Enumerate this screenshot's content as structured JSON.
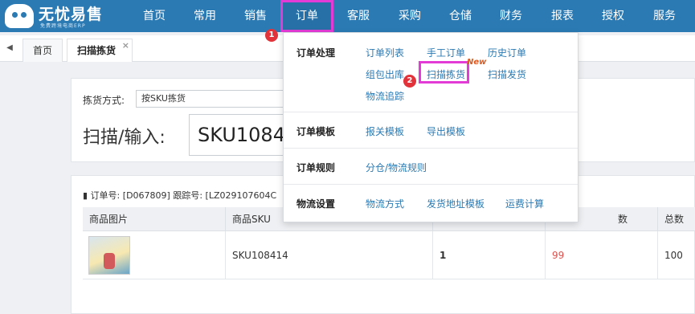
{
  "brand": {
    "title": "无忧易售",
    "subtitle": "免费跨境电商ERP"
  },
  "nav": [
    "首页",
    "常用",
    "销售",
    "订单",
    "客服",
    "采购",
    "仓储",
    "财务",
    "报表",
    "授权",
    "服务"
  ],
  "active_nav": "订单",
  "tabs": [
    "首页",
    "扫描拣货"
  ],
  "picking": {
    "method_label": "拣货方式:",
    "method_value": "按SKU拣货",
    "scan_label": "扫描/输入:",
    "scan_value": "SKU1084"
  },
  "order": {
    "order_no_label": "订单号:",
    "order_no": "[D067809]",
    "tracking_label": "跟踪号:",
    "tracking_no": "[LZ029107604C"
  },
  "table": {
    "headers": [
      "商品图片",
      "商品SKU",
      "",
      "数",
      "总数"
    ],
    "rows": [
      {
        "sku": "SKU108414",
        "picked": "1",
        "count": "99",
        "total": "100"
      }
    ]
  },
  "menu": {
    "groups": [
      {
        "title": "订单处理",
        "links": [
          "订单列表",
          "手工订单",
          "历史订单",
          "组包出库",
          "扫描拣货",
          "扫描发货",
          "物流追踪"
        ]
      },
      {
        "title": "订单模板",
        "links": [
          "报关模板",
          "导出模板"
        ]
      },
      {
        "title": "订单规则",
        "links": [
          "分仓/物流规则"
        ]
      },
      {
        "title": "物流设置",
        "links": [
          "物流方式",
          "发货地址模板",
          "运费计算"
        ]
      }
    ],
    "new_badge": "New"
  },
  "steps": [
    "1",
    "2"
  ],
  "colors": {
    "nav_bg": "#2b7ab3",
    "highlight": "#e23bd6",
    "link": "#2b7ab3",
    "step_badge": "#e2333a",
    "count_value": "#d9534f"
  }
}
